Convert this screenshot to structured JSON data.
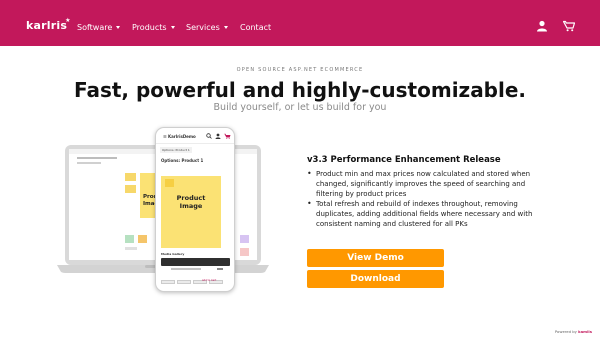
{
  "navbar": {
    "logo": "karlris",
    "logo_sup": "★",
    "items": [
      {
        "label": "Software",
        "dropdown": true
      },
      {
        "label": "Products",
        "dropdown": true
      },
      {
        "label": "Services",
        "dropdown": true
      },
      {
        "label": "Contact",
        "dropdown": false
      }
    ],
    "icons": [
      "user-icon",
      "cart-icon"
    ],
    "color": "#c2185b"
  },
  "hero": {
    "tagline": "OPEN SOURCE ASP.NET ECOMMERCE",
    "title": "Fast, powerful and highly-customizable.",
    "subtitle": "Build yourself, or let us build for you"
  },
  "mockup": {
    "phone": {
      "logo": "☰ KarlrisDemo",
      "breadcrumb": "Options: Product 1",
      "title": "Options: Product 1",
      "image_label": "Product\nImage",
      "media_gallery": "Media Gallery",
      "cart_text": "Add to Cart"
    },
    "laptop": {
      "image_label": "Product\nImage"
    }
  },
  "release": {
    "title": "v3.3 Performance Enhancement Release",
    "bullets": [
      "Product min and max prices now calculated and stored when changed, significantly improves the speed of searching and filtering by product prices",
      "Total refresh and rebuild of indexes throughout, removing duplicates, adding additional fields where necessary and with consistent naming and clustered for all PKs"
    ]
  },
  "buttons": {
    "view_demo": "View Demo",
    "download": "Download",
    "color": "#ff9800"
  },
  "footer": {
    "powered_prefix": "Powered by ",
    "powered_brand": "kamlis"
  }
}
